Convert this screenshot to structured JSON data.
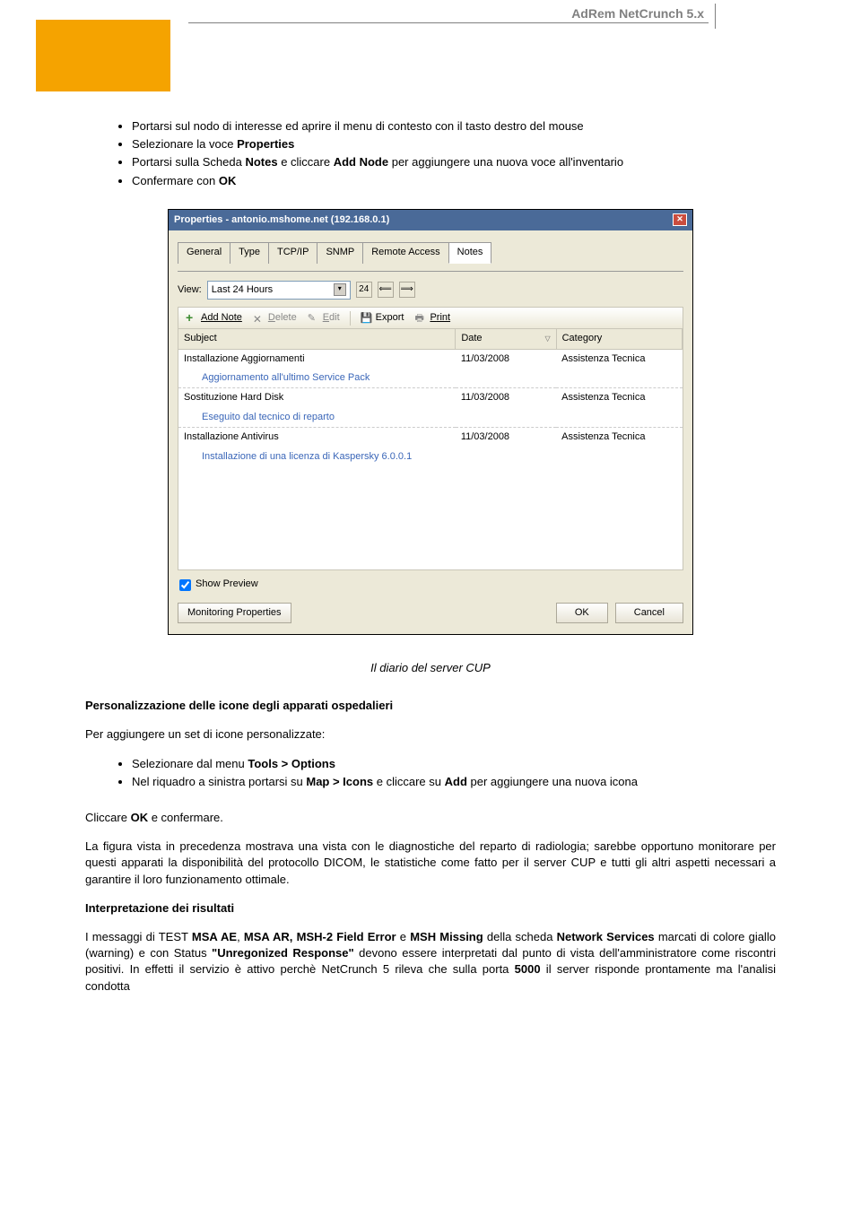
{
  "header": {
    "title": "AdRem NetCrunch 5.x"
  },
  "intro_list": [
    "Portarsi sul nodo di interesse ed aprire il menu di contesto con il tasto destro del mouse",
    "Selezionare la voce <b>Properties</b>",
    "Portarsi sulla Scheda <b>Notes</b> e cliccare <b>Add Node</b> per aggiungere una nuova voce all'inventario",
    "Confermare con <b>OK</b>"
  ],
  "dialog": {
    "title": "Properties - antonio.mshome.net (192.168.0.1)",
    "tabs": [
      "General",
      "Type",
      "TCP/IP",
      "SNMP",
      "Remote Access",
      "Notes"
    ],
    "active_tab": "Notes",
    "view_label": "View:",
    "view_value": "Last 24 Hours",
    "icon24": "24",
    "toolbar": {
      "add": "Add Note",
      "delete": "Delete",
      "edit": "Edit",
      "export": "Export",
      "print": "Print"
    },
    "columns": {
      "subject": "Subject",
      "date": "Date",
      "category": "Category"
    },
    "rows": [
      {
        "subject": "Installazione Aggiornamenti",
        "date": "11/03/2008",
        "category": "Assistenza Tecnica",
        "detail": "Aggiornamento all'ultimo Service Pack"
      },
      {
        "subject": "Sostituzione Hard Disk",
        "date": "11/03/2008",
        "category": "Assistenza Tecnica",
        "detail": "Eseguito dal tecnico di reparto"
      },
      {
        "subject": "Installazione Antivirus",
        "date": "11/03/2008",
        "category": "Assistenza Tecnica",
        "detail": "Installazione di una licenza di Kaspersky 6.0.0.1"
      }
    ],
    "show_preview": "Show Preview",
    "monitoring": "Monitoring Properties",
    "ok": "OK",
    "cancel": "Cancel"
  },
  "caption": "Il diario del server CUP",
  "section1": {
    "heading": "Personalizzazione delle icone degli apparati ospedalieri",
    "p1": "Per aggiungere un set di icone personalizzate:",
    "list": [
      "Selezionare dal menu <b>Tools > Options</b>",
      "Nel riquadro a sinistra portarsi su <b>Map > Icons</b> e cliccare su <b>Add</b> per aggiungere una nuova icona"
    ],
    "p2": "Cliccare <b>OK</b> e confermare.",
    "p3": "La figura vista in precedenza mostrava una vista con le diagnostiche del reparto di radiologia; sarebbe opportuno monitorare per questi apparati la disponibilità del protocollo DICOM, le statistiche come fatto per il server CUP e tutti gli altri aspetti necessari a garantire il loro funzionamento ottimale."
  },
  "section2": {
    "heading": "Interpretazione dei risultati",
    "p1": "I messaggi di TEST <b>MSA AE</b>, <b>MSA AR, MSH-2 Field Error</b> e <b>MSH Missing</b> della scheda <b>Network Services</b> marcati di colore giallo (warning) e con Status <b>\"Unregonized Response\"</b> devono essere interpretati dal punto di vista dell'amministratore come riscontri positivi. In effetti il servizio è attivo perchè NetCrunch 5 rileva che sulla porta <b>5000</b> il server risponde prontamente ma l'analisi condotta"
  }
}
